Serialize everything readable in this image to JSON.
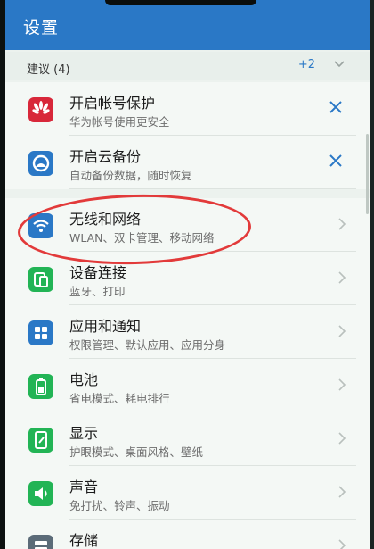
{
  "header": {
    "title": "设置"
  },
  "suggestions": {
    "label": "建议 (4)",
    "count": "+2"
  },
  "items": [
    {
      "label": "开启帐号保护",
      "sub": "华为帐号使用更安全",
      "icon": "huawei-logo-icon",
      "color": "#d8283a",
      "action": "close"
    },
    {
      "label": "开启云备份",
      "sub": "自动备份数据，随时恢复",
      "icon": "cloud-backup-icon",
      "color": "#2a78c6",
      "action": "close"
    },
    {
      "label": "无线和网络",
      "sub": "WLAN、双卡管理、移动网络",
      "icon": "wifi-icon",
      "color": "#2a78c6",
      "action": "chevron"
    },
    {
      "label": "设备连接",
      "sub": "蓝牙、打印",
      "icon": "device-connection-icon",
      "color": "#22b455",
      "action": "chevron"
    },
    {
      "label": "应用和通知",
      "sub": "权限管理、默认应用、应用分身",
      "icon": "apps-icon",
      "color": "#2a78c6",
      "action": "chevron"
    },
    {
      "label": "电池",
      "sub": "省电模式、耗电排行",
      "icon": "battery-icon",
      "color": "#22b455",
      "action": "chevron"
    },
    {
      "label": "显示",
      "sub": "护眼模式、桌面风格、壁纸",
      "icon": "display-icon",
      "color": "#22b455",
      "action": "chevron"
    },
    {
      "label": "声音",
      "sub": "免打扰、铃声、振动",
      "icon": "sound-icon",
      "color": "#22b455",
      "action": "chevron"
    },
    {
      "label": "存储",
      "sub": "",
      "icon": "storage-icon",
      "color": "#5b6b78",
      "action": "chevron"
    }
  ],
  "annotation": {
    "shape": "red-ellipse",
    "color": "#e23a3a",
    "target": "无线和网络"
  }
}
